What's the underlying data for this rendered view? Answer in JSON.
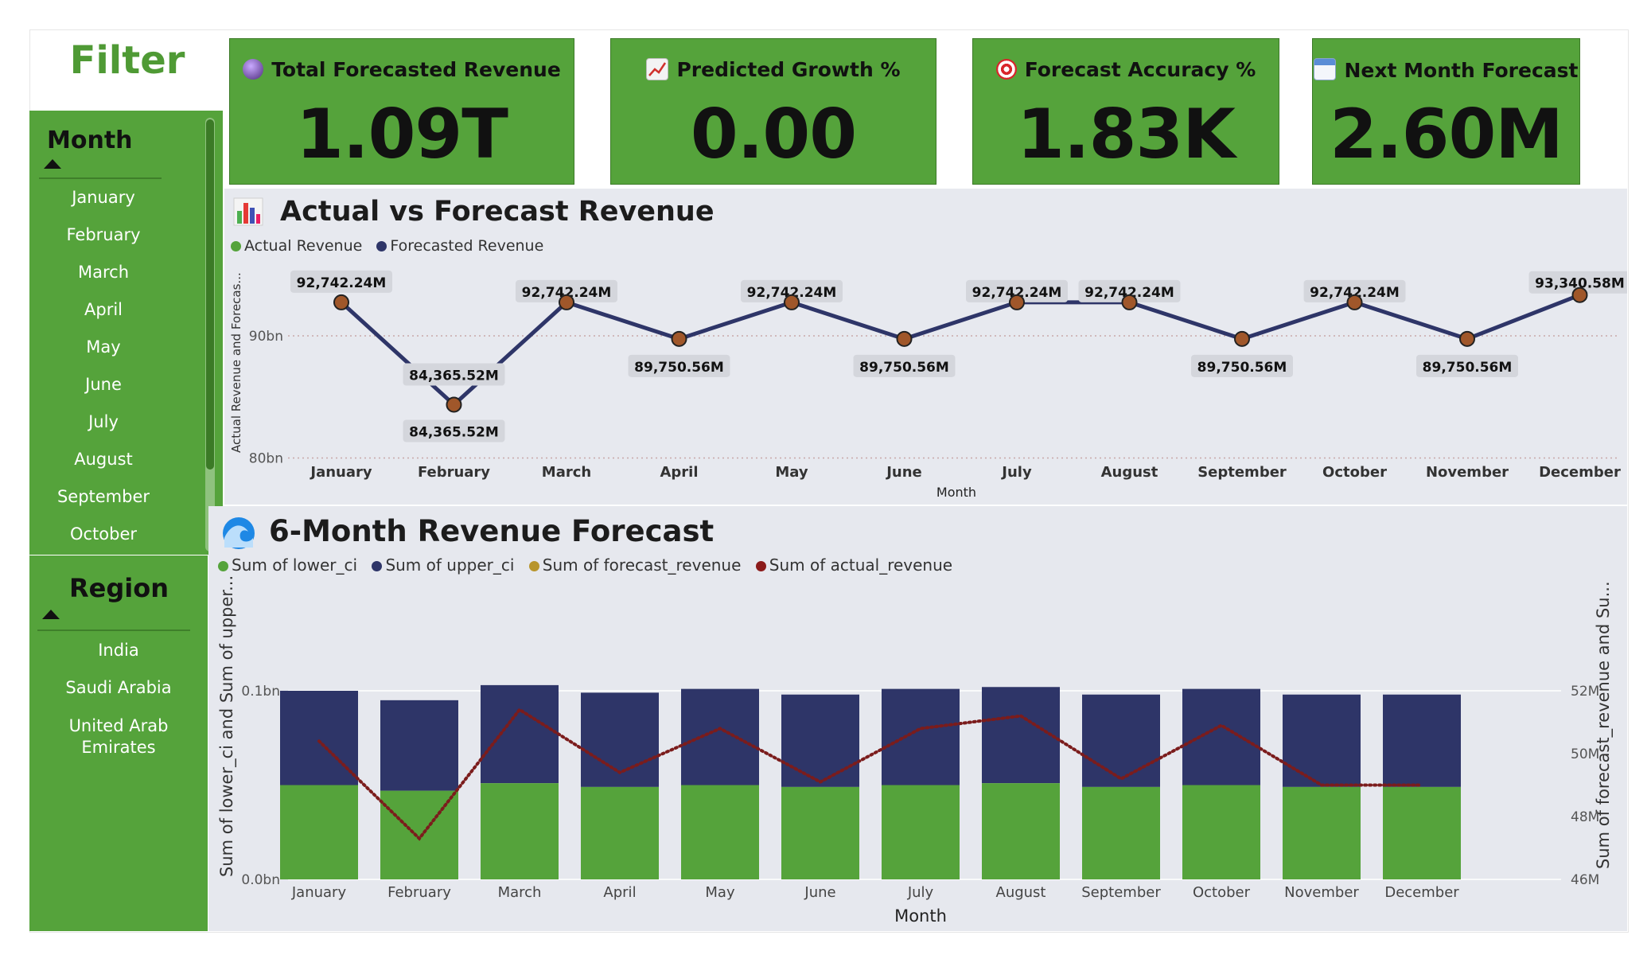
{
  "filter": {
    "title": "Filter",
    "month": {
      "title": "Month",
      "items": [
        "January",
        "February",
        "March",
        "April",
        "May",
        "June",
        "July",
        "August",
        "September",
        "October"
      ]
    },
    "region": {
      "title": "Region",
      "items": [
        "India",
        "Saudi Arabia",
        "United Arab Emirates"
      ]
    }
  },
  "kpis": [
    {
      "label": "Total Forecasted Revenue",
      "value": "1.09T",
      "icon": "crystal-ball-icon"
    },
    {
      "label": "Predicted Growth %",
      "value": "0.00",
      "icon": "chart-increasing-icon"
    },
    {
      "label": "Forecast Accuracy %",
      "value": "1.83K",
      "icon": "target-icon"
    },
    {
      "label": "Next Month Forecast",
      "value": "2.60M",
      "icon": "calendar-icon"
    }
  ],
  "colors": {
    "brand_green": "#55a33b",
    "title_green": "#4f9a35",
    "navy": "#2e3568",
    "marker": "#a0572a",
    "dotted_red": "#7b1c1c",
    "legend_gold": "#b8952c"
  },
  "line_chart": {
    "title": "Actual vs Forecast Revenue",
    "icon": "bar-chart-icon",
    "legend": [
      "Actual Revenue",
      "Forecasted Revenue"
    ],
    "chart_data": {
      "type": "line",
      "title": "Actual vs Forecast Revenue",
      "xlabel": "Month",
      "ylabel": "Actual Revenue and Forecas...",
      "categories": [
        "January",
        "February",
        "March",
        "April",
        "May",
        "June",
        "July",
        "August",
        "September",
        "October",
        "November",
        "December"
      ],
      "series": [
        {
          "name": "Forecasted Revenue",
          "values": [
            92742.24,
            84365.52,
            92742.24,
            89750.56,
            92742.24,
            89750.56,
            92742.24,
            92742.24,
            89750.56,
            92742.24,
            89750.56,
            93340.58
          ]
        }
      ],
      "labels": [
        "92,742.24M",
        "84,365.52M",
        "92,742.24M",
        "89,750.56M",
        "92,742.24M",
        "89,750.56M",
        "92,742.24M",
        "92,742.24M",
        "89,750.56M",
        "92,742.24M",
        "89,750.56M",
        "93,340.58M"
      ],
      "yticks": [
        "80bn",
        "90bn"
      ],
      "ylim": [
        80000,
        95000
      ],
      "grid": true,
      "legend_position": "top-left"
    }
  },
  "combo_chart": {
    "title": "6-Month Revenue Forecast",
    "icon": "wave-icon",
    "legend": [
      "Sum of lower_ci",
      "Sum of upper_ci",
      "Sum of forecast_revenue",
      "Sum of actual_revenue"
    ],
    "chart_data": {
      "type": "bar",
      "title": "6-Month Revenue Forecast",
      "xlabel": "Month",
      "ylabel": "Sum of lower_ci and Sum of upper...",
      "y2label": "Sum of forecast_revenue and Su...",
      "categories": [
        "January",
        "February",
        "March",
        "April",
        "May",
        "June",
        "July",
        "August",
        "September",
        "October",
        "November",
        "December"
      ],
      "series": [
        {
          "name": "Sum of lower_ci",
          "values": [
            0.05,
            0.047,
            0.051,
            0.049,
            0.05,
            0.049,
            0.05,
            0.051,
            0.049,
            0.05,
            0.049,
            0.049
          ]
        },
        {
          "name": "Sum of upper_ci",
          "values": [
            0.05,
            0.048,
            0.052,
            0.05,
            0.051,
            0.049,
            0.051,
            0.051,
            0.049,
            0.051,
            0.049,
            0.049
          ]
        },
        {
          "name": "Sum of actual_revenue",
          "axis": "right",
          "values": [
            50.4,
            47.3,
            51.4,
            49.4,
            50.8,
            49.1,
            50.8,
            51.2,
            49.2,
            50.9,
            49.0,
            49.0
          ]
        }
      ],
      "yticks_left": [
        "0.0bn",
        "0.1bn"
      ],
      "yticks_right": [
        "46M",
        "48M",
        "50M",
        "52M"
      ],
      "ylim": [
        0,
        0.1
      ],
      "y2lim": [
        46,
        52
      ],
      "grid": true,
      "legend_position": "top-left"
    }
  }
}
